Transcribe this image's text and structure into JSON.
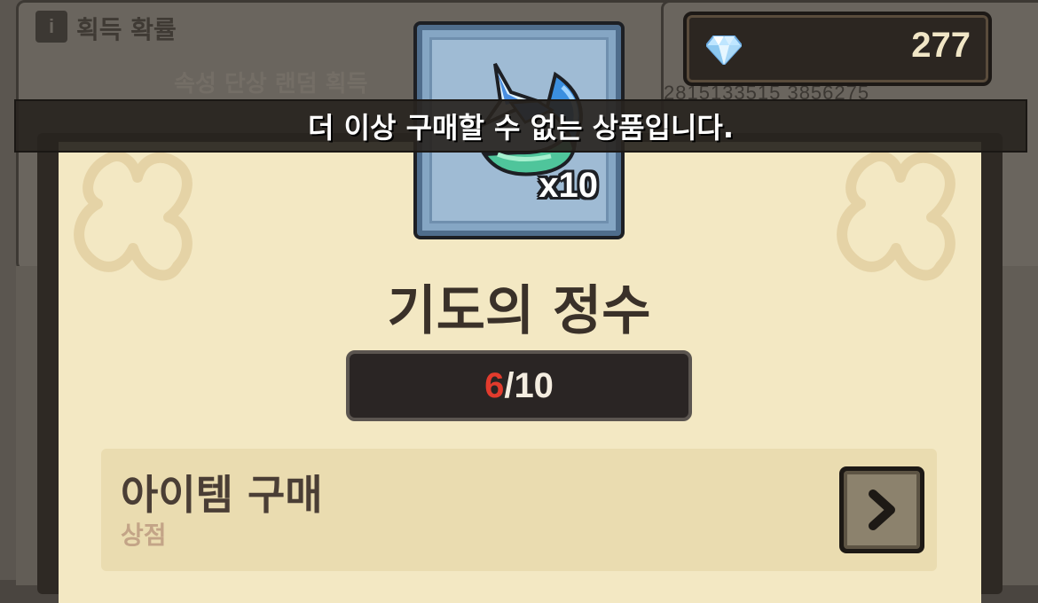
{
  "background": {
    "header_title": "획득 확률",
    "subtitle": "속성 단상 랜덤 획득",
    "numbers": "2815133515 3856275"
  },
  "currency": {
    "icon": "diamond-icon",
    "amount": "277"
  },
  "toast": {
    "message": "더 이상 구매할 수 없는 상품입니다."
  },
  "item": {
    "icon": "essence-of-prayer-icon",
    "quantity": "x10",
    "name": "기도의 정수"
  },
  "purchase_limit": {
    "current": "6",
    "separator": "/",
    "max": "10",
    "current_color": "#e23b2d"
  },
  "source": {
    "title": "아이템 구매",
    "subtitle": "상점",
    "button_icon": "chevron-right-icon"
  }
}
